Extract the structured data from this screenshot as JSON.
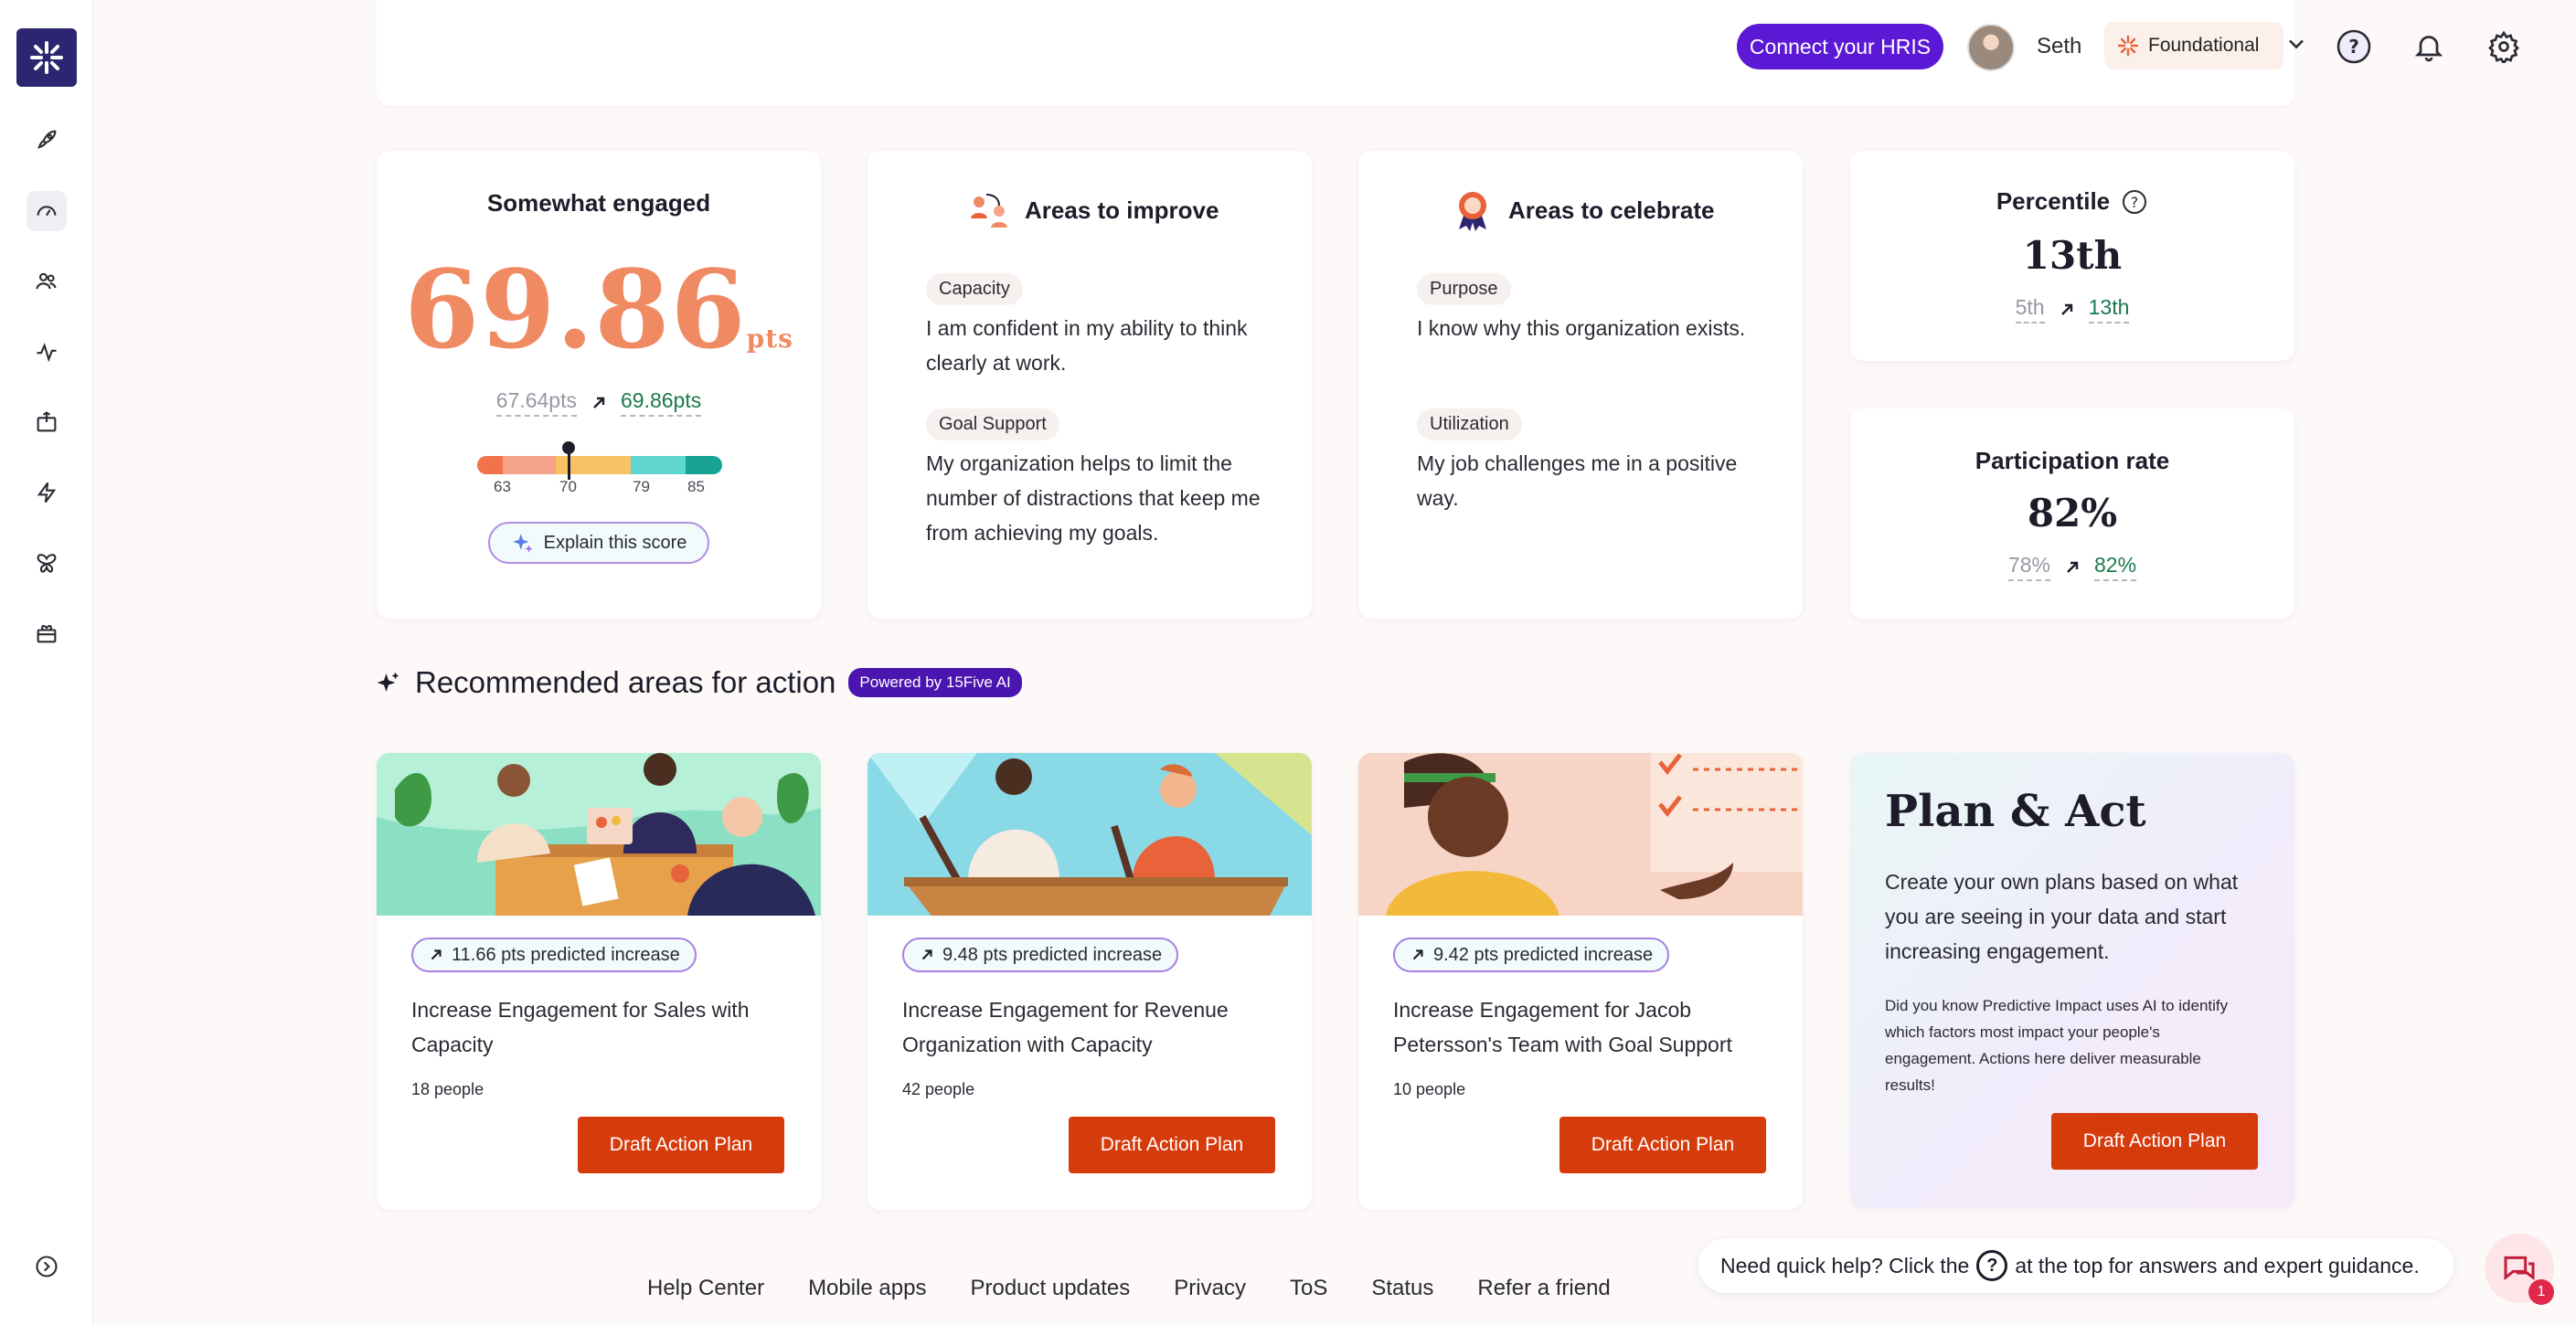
{
  "header": {
    "hris_button": "Connect your HRIS",
    "user_name": "Seth",
    "plan": "Foundational"
  },
  "engagement": {
    "title": "Somewhat engaged",
    "score": "69.86",
    "unit": "pts",
    "previous": "67.64pts",
    "current": "69.86pts",
    "gauge_labels": [
      "63",
      "70",
      "79",
      "85"
    ],
    "gauge_value": 69.86,
    "explain_button": "Explain this score"
  },
  "improve": {
    "title": "Areas to improve",
    "items": [
      {
        "tag": "Capacity",
        "text": "I am confident in my ability to think clearly at work."
      },
      {
        "tag": "Goal Support",
        "text": "My organization helps to limit the number of distractions that keep me from achieving my goals."
      }
    ]
  },
  "celebrate": {
    "title": "Areas to celebrate",
    "items": [
      {
        "tag": "Purpose",
        "text": "I know why this organization exists."
      },
      {
        "tag": "Utilization",
        "text": "My job challenges me in a positive way."
      }
    ]
  },
  "percentile": {
    "title": "Percentile",
    "value": "13th",
    "previous": "5th",
    "current": "13th"
  },
  "participation": {
    "title": "Participation rate",
    "value": "82%",
    "previous": "78%",
    "current": "82%"
  },
  "recommended": {
    "title": "Recommended areas for action",
    "badge": "Powered by 15Five AI",
    "cards": [
      {
        "increase": "11.66 pts predicted increase",
        "title": "Increase Engagement for Sales with Capacity",
        "people": "18 people",
        "button": "Draft Action Plan"
      },
      {
        "increase": "9.48 pts predicted increase",
        "title": "Increase Engagement for Revenue Organization with Capacity",
        "people": "42 people",
        "button": "Draft Action Plan"
      },
      {
        "increase": "9.42 pts predicted increase",
        "title": "Increase Engagement for Jacob Petersson's Team with Goal Support",
        "people": "10 people",
        "button": "Draft Action Plan"
      }
    ],
    "plan_act": {
      "title": "Plan & Act",
      "description": "Create your own plans based on what you are seeing in your data and start increasing engagement.",
      "note": "Did you know Predictive Impact uses AI to identify which factors most impact your people's engagement. Actions here deliver measurable results!",
      "button": "Draft Action Plan"
    }
  },
  "footer": {
    "links": [
      "Help Center",
      "Mobile apps",
      "Product updates",
      "Privacy",
      "ToS",
      "Status",
      "Refer a friend"
    ],
    "help_before": "Need quick help? Click the",
    "help_after": "at the top for answers and expert guidance.",
    "chat_count": "1"
  }
}
